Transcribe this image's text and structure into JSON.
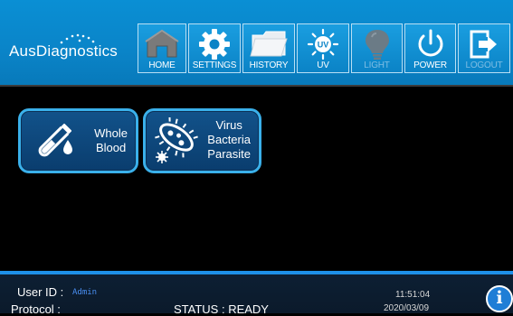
{
  "brand": {
    "logo_text": "AusDiagnostics"
  },
  "nav": {
    "home": "HOME",
    "settings": "SETTINGS",
    "history": "HISTORY",
    "uv": "UV",
    "uv_badge": "UV",
    "light": "LIGHT",
    "power": "POWER",
    "logout": "LOGOUT"
  },
  "tiles": {
    "whole_blood": {
      "line1": "Whole",
      "line2": "Blood"
    },
    "pathogens": {
      "line1": "Virus",
      "line2": "Bacteria",
      "line3": "Parasite"
    }
  },
  "status": {
    "user_id_label": "User ID :",
    "user_id_value": "Admin",
    "protocol_label": "Protocol :",
    "status_text": "STATUS : READY",
    "time": "11:51:04",
    "date": "2020/03/09",
    "info_glyph": "i"
  },
  "colors": {
    "header_blue": "#0a84c8",
    "tile_border": "#3ab0ea",
    "user_id_value": "#4a8ff2"
  }
}
